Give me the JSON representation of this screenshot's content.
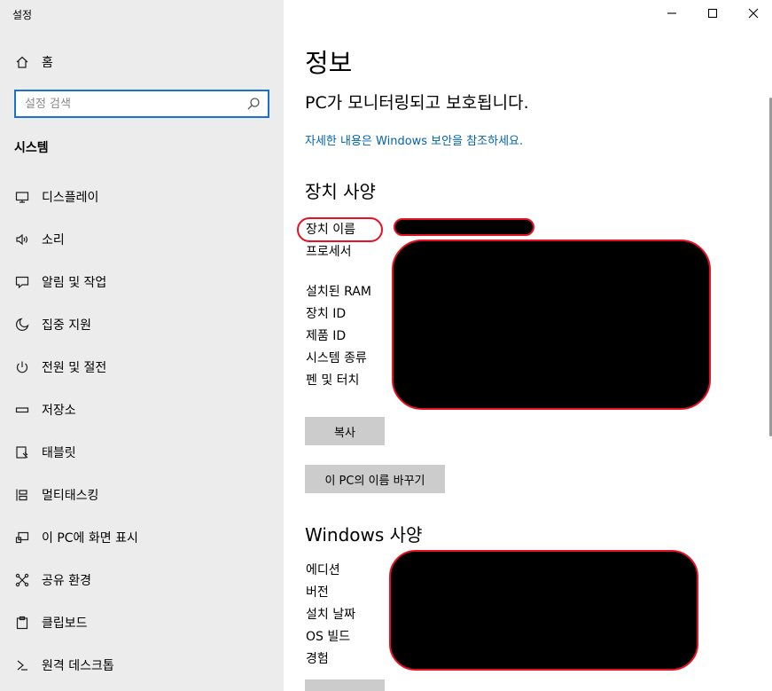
{
  "app_title": "설정",
  "sidebar": {
    "home_label": "홈",
    "search_placeholder": "설정 검색",
    "section_title": "시스템",
    "items": [
      {
        "label": "디스플레이",
        "icon": "monitor-icon"
      },
      {
        "label": "소리",
        "icon": "speaker-icon"
      },
      {
        "label": "알림 및 작업",
        "icon": "notification-icon"
      },
      {
        "label": "집중 지원",
        "icon": "moon-icon"
      },
      {
        "label": "전원 및 절전",
        "icon": "power-icon"
      },
      {
        "label": "저장소",
        "icon": "storage-icon"
      },
      {
        "label": "태블릿",
        "icon": "tablet-icon"
      },
      {
        "label": "멀티태스킹",
        "icon": "multitasking-icon"
      },
      {
        "label": "이 PC에 화면 표시",
        "icon": "project-icon"
      },
      {
        "label": "공유 환경",
        "icon": "share-icon"
      },
      {
        "label": "클립보드",
        "icon": "clipboard-icon"
      },
      {
        "label": "원격 데스크톱",
        "icon": "remote-desktop-icon"
      }
    ]
  },
  "main": {
    "title": "정보",
    "protect_message": "PC가 모니터링되고 보호됩니다.",
    "detail_link": "자세한 내용은 Windows 보안을 참조하세요.",
    "device_spec": {
      "heading": "장치 사양",
      "labels": [
        "장치 이름",
        "프로세서",
        "설치된 RAM",
        "장치 ID",
        "제품 ID",
        "시스템 종류",
        "펜 및 터치"
      ],
      "copy_button": "복사",
      "rename_button": "이 PC의 이름 바꾸기"
    },
    "windows_spec": {
      "heading": "Windows 사양",
      "labels": [
        "에디션",
        "버전",
        "설치 날짜",
        "OS 빌드",
        "경험"
      ]
    }
  },
  "colors": {
    "accent": "#0063b1",
    "search_border": "#1a73c8",
    "annotation_red": "#e81123",
    "sidebar_bg": "#ececec",
    "button_bg": "#cccccc"
  }
}
